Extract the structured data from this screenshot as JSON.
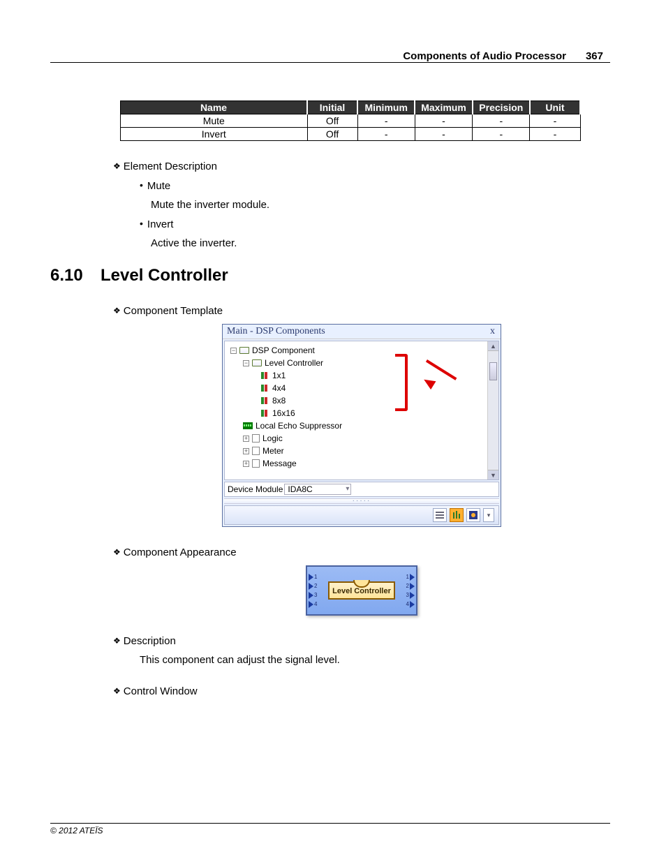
{
  "header": {
    "title": "Components of Audio Processor",
    "page": "367"
  },
  "table": {
    "headers": {
      "name": "Name",
      "initial": "Initial",
      "minimum": "Minimum",
      "maximum": "Maximum",
      "precision": "Precision",
      "unit": "Unit"
    },
    "rows": [
      {
        "name": "Mute",
        "initial": "Off",
        "minimum": "-",
        "maximum": "-",
        "precision": "-",
        "unit": "-"
      },
      {
        "name": "Invert",
        "initial": "Off",
        "minimum": "-",
        "maximum": "-",
        "precision": "-",
        "unit": "-"
      }
    ]
  },
  "desc": {
    "heading": "Element Description",
    "items": [
      {
        "title": "Mute",
        "body": "Mute the inverter module."
      },
      {
        "title": "Invert",
        "body": "Active the inverter."
      }
    ]
  },
  "section": {
    "number": "6.10",
    "title": "Level Controller"
  },
  "comp_template_h": "Component Template",
  "comp_appearance_h": "Component Appearance",
  "desc_h": "Description",
  "desc_body": "This component can adjust the signal level.",
  "ctrl_win_h": "Control Window",
  "dsp": {
    "title": "Main - DSP Components",
    "close": "x",
    "tree": {
      "root": "DSP Component",
      "level_controller": "Level Controller",
      "items": [
        "1x1",
        "4x4",
        "8x8",
        "16x16"
      ],
      "les": "Local Echo Suppressor",
      "logic": "Logic",
      "meter": "Meter",
      "message": "Message"
    },
    "device_module_label": "Device Module",
    "device_module_value": "IDA8C"
  },
  "appearance": {
    "label": "Level Controller",
    "ports": [
      "1",
      "2",
      "3",
      "4"
    ]
  },
  "footer": "© 2012 ATEÏS"
}
